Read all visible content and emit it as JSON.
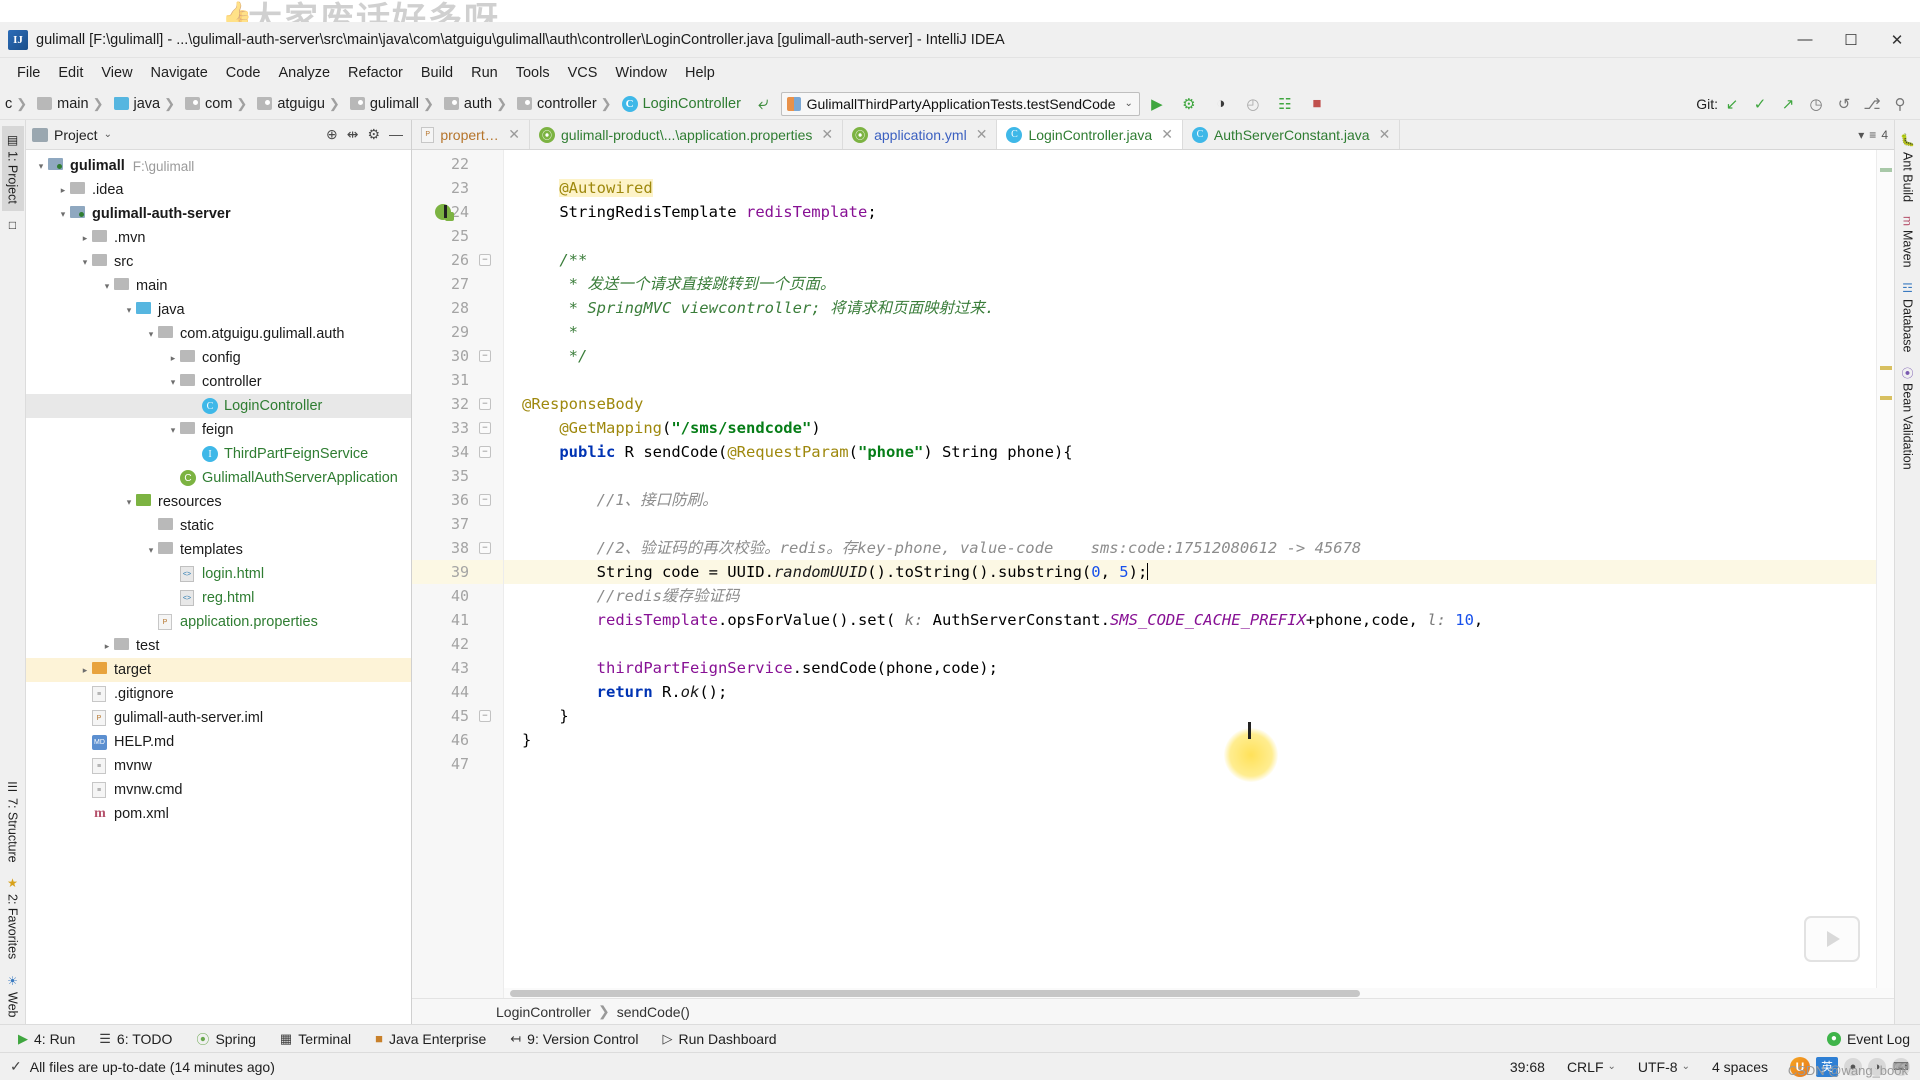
{
  "window": {
    "title": "gulimall [F:\\gulimall] - ...\\gulimall-auth-server\\src\\main\\java\\com\\atguigu\\gulimall\\auth\\controller\\LoginController.java [gulimall-auth-server] - IntelliJ IDEA",
    "app_icon_label": "IJ",
    "minimize": "—",
    "maximize": "☐",
    "close": "✕",
    "watermark": "大家废话好多呀"
  },
  "menubar": {
    "items": [
      "File",
      "Edit",
      "View",
      "Navigate",
      "Code",
      "Analyze",
      "Refactor",
      "Build",
      "Run",
      "Tools",
      "VCS",
      "Window",
      "Help"
    ]
  },
  "navbar": {
    "crumbs": [
      {
        "label": "c",
        "icon": "none"
      },
      {
        "label": "main",
        "icon": "folder-grey"
      },
      {
        "label": "java",
        "icon": "folder-blue"
      },
      {
        "label": "com",
        "icon": "folder-src"
      },
      {
        "label": "atguigu",
        "icon": "folder-src"
      },
      {
        "label": "gulimall",
        "icon": "folder-src"
      },
      {
        "label": "auth",
        "icon": "folder-src"
      },
      {
        "label": "controller",
        "icon": "folder-src"
      },
      {
        "label": "LoginController",
        "icon": "class-c"
      }
    ],
    "run_config": "GulimallThirdPartyApplicationTests.testSendCode",
    "run_config_caret": "⌄",
    "tools": [
      {
        "name": "run-button",
        "glyph": "▶"
      },
      {
        "name": "debug-button",
        "glyph": "⚙"
      },
      {
        "name": "run-with-coverage-button",
        "glyph": "◑"
      },
      {
        "name": "profiler-button",
        "glyph": "◴"
      },
      {
        "name": "attach-debugger-button",
        "glyph": "☷"
      },
      {
        "name": "stop-button",
        "glyph": "■"
      }
    ],
    "git_label": "Git:",
    "git_tools": [
      {
        "name": "git-update-icon",
        "glyph": "↙"
      },
      {
        "name": "git-commit-icon",
        "glyph": "✓"
      },
      {
        "name": "git-push-icon",
        "glyph": "↗"
      },
      {
        "name": "git-history-icon",
        "glyph": "◷"
      },
      {
        "name": "git-revert-icon",
        "glyph": "↺"
      },
      {
        "name": "git-branch-icon",
        "glyph": "⎇"
      },
      {
        "name": "search-icon",
        "glyph": "⚲"
      }
    ]
  },
  "project_pane": {
    "title": "Project",
    "caret": "⌄",
    "actions": [
      {
        "name": "locate-file-icon",
        "glyph": "⊕"
      },
      {
        "name": "collapse-all-icon",
        "glyph": "⇹"
      },
      {
        "name": "settings-gear-icon",
        "glyph": "⚙"
      },
      {
        "name": "hide-panel-icon",
        "glyph": "—"
      }
    ],
    "tree": [
      {
        "depth": 0,
        "arrow": "⌄",
        "icon": "folder-mod",
        "label": "gulimall",
        "bold": true,
        "sub": "F:\\gulimall",
        "state": "expanded"
      },
      {
        "depth": 1,
        "arrow": "›",
        "icon": "folder-grey",
        "label": ".idea",
        "state": "collapsed"
      },
      {
        "depth": 1,
        "arrow": "⌄",
        "icon": "folder-mod",
        "label": "gulimall-auth-server",
        "bold": true,
        "state": "expanded"
      },
      {
        "depth": 2,
        "arrow": "›",
        "icon": "folder-grey",
        "label": ".mvn",
        "state": "collapsed"
      },
      {
        "depth": 2,
        "arrow": "⌄",
        "icon": "folder-grey",
        "label": "src",
        "state": "expanded"
      },
      {
        "depth": 3,
        "arrow": "⌄",
        "icon": "folder-grey",
        "label": "main",
        "state": "expanded"
      },
      {
        "depth": 4,
        "arrow": "⌄",
        "icon": "folder-blue",
        "label": "java",
        "state": "expanded"
      },
      {
        "depth": 5,
        "arrow": "⌄",
        "icon": "folder-grey",
        "label": "com.atguigu.gulimall.auth",
        "state": "expanded"
      },
      {
        "depth": 6,
        "arrow": "›",
        "icon": "folder-grey",
        "label": "config",
        "state": "collapsed"
      },
      {
        "depth": 6,
        "arrow": "⌄",
        "icon": "folder-grey",
        "label": "controller",
        "state": "expanded"
      },
      {
        "depth": 7,
        "arrow": "",
        "icon": "class-c",
        "label": "LoginController",
        "green": true,
        "selected": true
      },
      {
        "depth": 6,
        "arrow": "⌄",
        "icon": "folder-grey",
        "label": "feign",
        "state": "expanded"
      },
      {
        "depth": 7,
        "arrow": "",
        "icon": "interface-i",
        "label": "ThirdPartFeignService",
        "green": true
      },
      {
        "depth": 6,
        "arrow": "",
        "icon": "spring-class",
        "label": "GulimallAuthServerApplication",
        "green": true
      },
      {
        "depth": 4,
        "arrow": "⌄",
        "icon": "folder-green",
        "label": "resources",
        "state": "expanded"
      },
      {
        "depth": 5,
        "arrow": "",
        "icon": "folder-grey",
        "label": "static"
      },
      {
        "depth": 5,
        "arrow": "⌄",
        "icon": "folder-grey",
        "label": "templates",
        "state": "expanded"
      },
      {
        "depth": 6,
        "arrow": "",
        "icon": "html-file",
        "label": "login.html",
        "green": true
      },
      {
        "depth": 6,
        "arrow": "",
        "icon": "html-file",
        "label": "reg.html",
        "green": true
      },
      {
        "depth": 5,
        "arrow": "",
        "icon": "props-file",
        "label": "application.properties",
        "green": true
      },
      {
        "depth": 3,
        "arrow": "›",
        "icon": "folder-grey",
        "label": "test",
        "state": "collapsed"
      },
      {
        "depth": 2,
        "arrow": "›",
        "icon": "folder-orange",
        "label": "target",
        "state": "collapsed",
        "highlight": true
      },
      {
        "depth": 2,
        "arrow": "",
        "icon": "file",
        "label": ".gitignore"
      },
      {
        "depth": 2,
        "arrow": "",
        "icon": "props-file",
        "label": "gulimall-auth-server.iml"
      },
      {
        "depth": 2,
        "arrow": "",
        "icon": "md-file",
        "label": "HELP.md"
      },
      {
        "depth": 2,
        "arrow": "",
        "icon": "file",
        "label": "mvnw"
      },
      {
        "depth": 2,
        "arrow": "",
        "icon": "file",
        "label": "mvnw.cmd"
      },
      {
        "depth": 2,
        "arrow": "",
        "icon": "maven-m",
        "label": "pom.xml"
      }
    ]
  },
  "left_rail": [
    {
      "label": "1: Project",
      "active": true,
      "icon": "project-icon"
    },
    {
      "label": "",
      "active": false,
      "icon": "favorites-small-icon"
    }
  ],
  "left_rail_bottom": [
    {
      "label": "7: Structure",
      "icon": "structure-icon"
    },
    {
      "label": "2: Favorites",
      "icon": "star-icon"
    },
    {
      "label": "Web",
      "icon": "web-icon"
    }
  ],
  "right_rail": [
    {
      "label": "Ant Build",
      "icon": "ant-icon"
    },
    {
      "label": "Maven",
      "icon": "maven-icon"
    },
    {
      "label": "Database",
      "icon": "database-icon"
    },
    {
      "label": "Bean Validation",
      "icon": "bean-icon"
    }
  ],
  "editor_tabs": [
    {
      "label": "properties",
      "icon": "props-icon",
      "active": false,
      "truncated": true,
      "color": "orange"
    },
    {
      "label": "gulimall-product\\...\\application.properties",
      "icon": "spring-icon",
      "active": false,
      "color": "green"
    },
    {
      "label": "application.yml",
      "icon": "spring-icon",
      "active": false,
      "color": "blue"
    },
    {
      "label": "LoginController.java",
      "icon": "class-icon",
      "active": true,
      "color": "green"
    },
    {
      "label": "AuthServerConstant.java",
      "icon": "class-icon",
      "active": false,
      "color": "green"
    }
  ],
  "editor_tab_actions": [
    {
      "name": "tab-list-icon",
      "glyph": "▾"
    },
    {
      "name": "split-icon",
      "glyph": "≡"
    },
    {
      "name": "tab-count",
      "glyph": "4"
    }
  ],
  "code": {
    "first_line": 22,
    "highlight_line": 39,
    "caret_position": "39:68",
    "lines": [
      {
        "n": 22,
        "text": ""
      },
      {
        "n": 23,
        "text": "    @Autowired",
        "fold": false
      },
      {
        "n": 24,
        "text": "    StringRedisTemplate redisTemplate;",
        "gutter_icon": "spring-bean-icon"
      },
      {
        "n": 25,
        "text": ""
      },
      {
        "n": 26,
        "text": "    /**",
        "fold": true
      },
      {
        "n": 27,
        "text": "     * 发送一个请求直接跳转到一个页面。"
      },
      {
        "n": 28,
        "text": "     * SpringMVC viewcontroller; 将请求和页面映射过来."
      },
      {
        "n": 29,
        "text": "     *"
      },
      {
        "n": 30,
        "text": "     */",
        "fold": true
      },
      {
        "n": 31,
        "text": ""
      },
      {
        "n": 32,
        "text": "    @ResponseBody",
        "fold": true
      },
      {
        "n": 33,
        "text": "    @GetMapping(\"/sms/sendcode\")",
        "fold": true
      },
      {
        "n": 34,
        "text": "    public R sendCode(@RequestParam(\"phone\") String phone){",
        "fold": true
      },
      {
        "n": 35,
        "text": ""
      },
      {
        "n": 36,
        "text": "        //1、接口防刷。",
        "fold": true
      },
      {
        "n": 37,
        "text": ""
      },
      {
        "n": 38,
        "text": "        //2、验证码的再次校验。redis。存key-phone, value-code    sms:code:17512080612 -> 45678",
        "fold": true
      },
      {
        "n": 39,
        "text": "        String code = UUID.randomUUID().toString().substring(0, 5);",
        "highlight": true
      },
      {
        "n": 40,
        "text": "        //redis缓存验证码"
      },
      {
        "n": 41,
        "text": "        redisTemplate.opsForValue().set( k: AuthServerConstant.SMS_CODE_CACHE_PREFIX+phone,code, l: 10,"
      },
      {
        "n": 42,
        "text": ""
      },
      {
        "n": 43,
        "text": "        thirdPartFeignService.sendCode(phone,code);"
      },
      {
        "n": 44,
        "text": "        return R.ok();"
      },
      {
        "n": 45,
        "text": "    }",
        "fold": true
      },
      {
        "n": 46,
        "text": "}"
      },
      {
        "n": 47,
        "text": ""
      }
    ]
  },
  "editor_breadcrumb": [
    "LoginController",
    "sendCode()"
  ],
  "bottom_toolwindows": [
    {
      "label": "4: Run",
      "icon": "run-triangle-icon"
    },
    {
      "label": "6: TODO",
      "icon": "todo-list-icon"
    },
    {
      "label": "Spring",
      "icon": "spring-leaf-icon"
    },
    {
      "label": "Terminal",
      "icon": "terminal-icon"
    },
    {
      "label": "Java Enterprise",
      "icon": "java-ee-icon"
    },
    {
      "label": "9: Version Control",
      "icon": "version-control-icon"
    },
    {
      "label": "Run Dashboard",
      "icon": "dashboard-icon"
    }
  ],
  "bottom_right": {
    "label": "Event Log",
    "icon": "event-log-icon"
  },
  "statusbar": {
    "message": "All files are up-to-date (14 minutes ago)",
    "caret": "39:68",
    "line_separator": "CRLF",
    "encoding": "UTF-8",
    "indent": "4 spaces",
    "caret_glyph": "⌄",
    "ime": [
      {
        "name": "sogou-ime-icon",
        "label": "U"
      },
      {
        "name": "ime-chinese-icon",
        "label": "英"
      },
      {
        "name": "ime-punct-icon",
        "label": "●"
      },
      {
        "name": "ime-mic-icon",
        "label": "◑"
      },
      {
        "name": "ime-keyboard-icon",
        "label": "⌨"
      }
    ],
    "watermark": "CSDN @wang_book"
  }
}
